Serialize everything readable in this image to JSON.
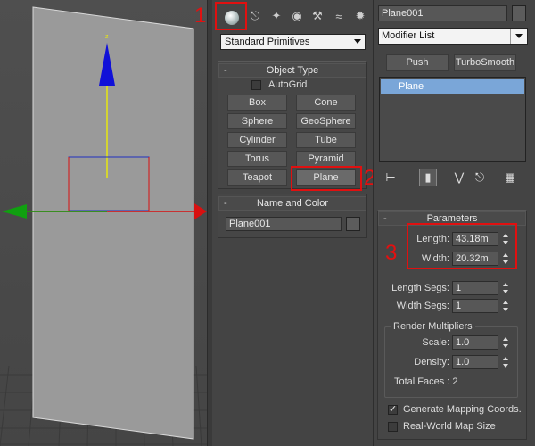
{
  "viewport": {
    "gizmo_z_label": "z"
  },
  "create_panel": {
    "category_dropdown": "Standard Primitives",
    "object_type": {
      "header": "Object Type",
      "autogrid_label": "AutoGrid",
      "buttons": [
        "Box",
        "Cone",
        "Sphere",
        "GeoSphere",
        "Cylinder",
        "Tube",
        "Torus",
        "Pyramid",
        "Teapot",
        "Plane"
      ]
    },
    "name_and_color": {
      "header": "Name and Color",
      "name_value": "Plane001"
    },
    "callouts": [
      "1",
      "2",
      "3"
    ]
  },
  "modify_panel": {
    "object_name": "Plane001",
    "modifier_list": "Modifier List",
    "push_label": "Push",
    "turbosmooth_label": "TurboSmooth",
    "stack_item": "Plane",
    "parameters": {
      "header": "Parameters",
      "length_label": "Length:",
      "length_value": "43.18m",
      "width_label": "Width:",
      "width_value": "20.32m",
      "length_segs_label": "Length Segs:",
      "length_segs_value": "1",
      "width_segs_label": "Width Segs:",
      "width_segs_value": "1",
      "render_multipliers_title": "Render Multipliers",
      "scale_label": "Scale:",
      "scale_value": "1.0",
      "density_label": "Density:",
      "density_value": "1.0",
      "total_faces": "Total Faces : 2",
      "gen_mapping_label": "Generate Mapping Coords.",
      "gen_mapping_checked": true,
      "real_world_label": "Real-World Map Size",
      "real_world_checked": false
    }
  },
  "colors": {
    "accent": "#e01010",
    "selection": "#7aa6d8",
    "gizmo_z": "#1010d8",
    "gizmo_x": "#d81010",
    "gizmo_y": "#10a010"
  }
}
